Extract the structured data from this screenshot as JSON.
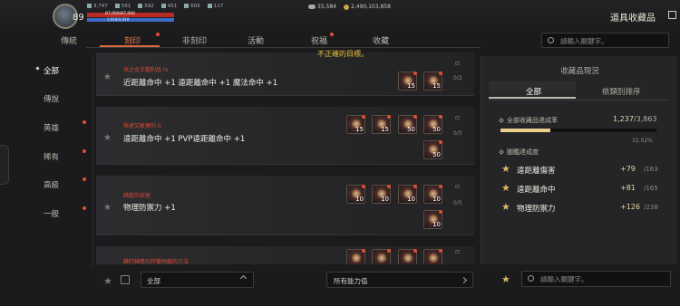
{
  "status": {
    "level": "89",
    "stats": [
      "3,747",
      "591",
      "592",
      "451",
      "605",
      "117"
    ],
    "hp": "87,000/87,000",
    "mp": "3,918/3,918"
  },
  "currency": {
    "diamond": "35,584",
    "gold": "2,490,103,858"
  },
  "page_title": "道具收藏品",
  "tabs": [
    "傳統",
    "刻印",
    "非刻印",
    "活動",
    "祝福",
    "收藏"
  ],
  "search_placeholder": "請輸入關鍵字。",
  "message": "不正確的目標。",
  "categories": [
    "全部",
    "傳說",
    "英雄",
    "稀有",
    "高級",
    "一般"
  ],
  "entries": [
    {
      "name": "冰之女王戰利品 IV",
      "effect": "近距離命中 +1 遠距離命中 +1 魔法命中 +1",
      "progress": "0/2",
      "items": [
        "15",
        "15"
      ]
    },
    {
      "name": "快速又敏捷的 II",
      "effect": "遠距離命中 +1 PVP遠距離命中 +1",
      "progress": "0/5",
      "items": [
        "15",
        "15",
        "50",
        "50",
        "50"
      ]
    },
    {
      "name": "暗殺的技術",
      "effect": "物理防禦力 +1",
      "progress": "0/5",
      "items": [
        "10",
        "10",
        "10",
        "10",
        "10"
      ]
    },
    {
      "name": "轉打錘算的狩獵飛龍的方法",
      "effect": "",
      "progress": "",
      "items": []
    }
  ],
  "filters": {
    "grade": "全部",
    "ability": "所有能力值"
  },
  "panel": {
    "title": "收藏品現況",
    "tab_all": "全部",
    "tab_type": "依類別排序",
    "rate_label": "全部收藏品達成率",
    "rate_value": "1,237",
    "rate_total": "/3,863",
    "rate_fraction": 0.3202,
    "rate_pct": "32.02%",
    "ach_label": "圖鑑達成度",
    "achievements": [
      {
        "name": "遠距離傷害",
        "gain": "+79",
        "max": "/163"
      },
      {
        "name": "遠距離命中",
        "gain": "+81",
        "max": "/165"
      },
      {
        "name": "物理防禦力",
        "gain": "+126",
        "max": "/238"
      }
    ]
  }
}
